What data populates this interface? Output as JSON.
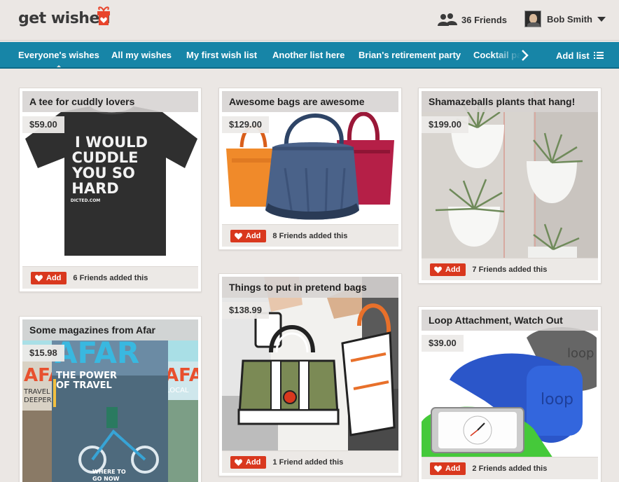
{
  "header": {
    "logo": "get wished",
    "friends_label": "36 Friends",
    "user_name": "Bob Smith"
  },
  "nav": {
    "tabs": [
      {
        "label": "Everyone's wishes"
      },
      {
        "label": "All my wishes"
      },
      {
        "label": "My first wish list"
      },
      {
        "label": "Another list here"
      },
      {
        "label": "Brian's retirement party"
      },
      {
        "label": "Cocktail party"
      }
    ],
    "add_list": "Add list"
  },
  "add_label": "Add",
  "cards": [
    {
      "title": "A tee for cuddly lovers",
      "price": "$59.00",
      "friends": "6 Friends added this",
      "shirt_text": [
        "I WOULD",
        "CUDDLE",
        "YOU SO",
        "HARD"
      ],
      "shirt_small": "DICTED.COM"
    },
    {
      "title": "Awesome bags are awesome",
      "price": "$129.00",
      "friends": "8 Friends added this"
    },
    {
      "title": "Shamazeballs plants that hang!",
      "price": "$199.00",
      "friends": "7 Friends added this"
    },
    {
      "title": "Some magazines from Afar",
      "price": "$15.98",
      "friends": "",
      "mag_title": "AFAR",
      "mag_head": [
        "THE POWER",
        "OF TRAVEL"
      ],
      "mag_left": [
        "TRAVEL",
        "DEEPER"
      ],
      "mag_right": "LOCAL",
      "mag_foot": [
        "WHERE TO",
        "GO NOW"
      ]
    },
    {
      "title": "Things to put in pretend bags",
      "price": "$138.99",
      "friends": "1 Friend added this"
    },
    {
      "title": "Loop Attachment, Watch Out",
      "price": "$39.00",
      "friends": "2 Friends added this",
      "loop": "loop"
    }
  ],
  "colors": {
    "nav": "#1785a7",
    "add_button": "#d9381e",
    "background": "#ebe7e4"
  }
}
